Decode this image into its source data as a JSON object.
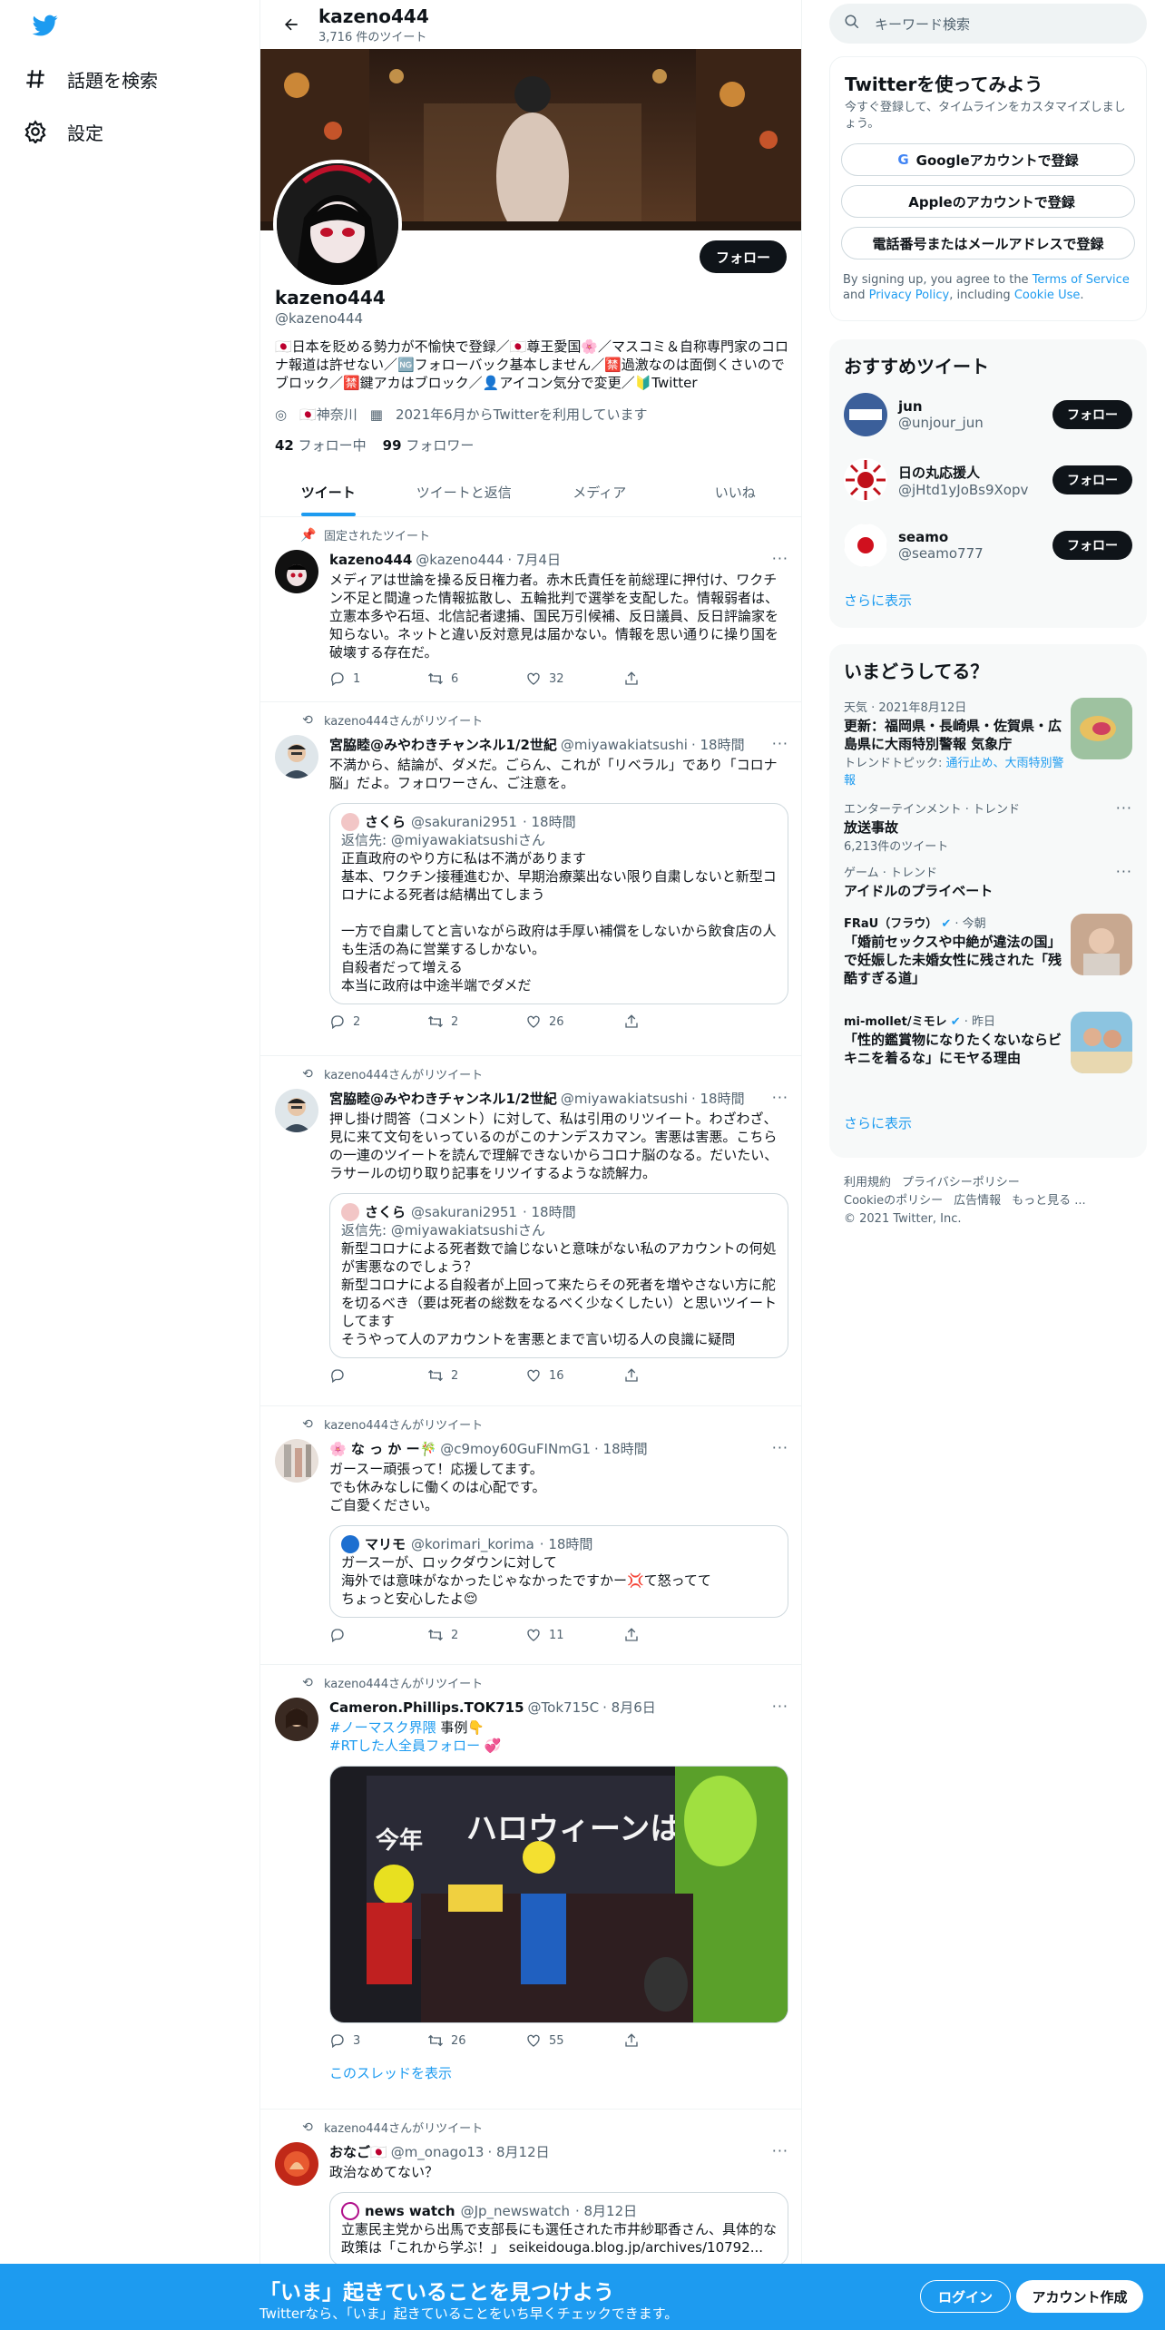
{
  "nav": {
    "explore": "話題を検索",
    "settings": "設定"
  },
  "header": {
    "name": "kazeno444",
    "tweet_count": "3,716 件のツイート"
  },
  "profile": {
    "follow": "フォロー",
    "name": "kazeno444",
    "handle": "@kazeno444",
    "bio": "🇯🇵日本を貶める勢力が不愉快で登録／🇯🇵尊王愛国🌸／マスコミ＆自称専門家のコロナ報道は許せない／🆖フォローバック基本しません／🈲過激なのは面倒くさいのでブロック／🈲鍵アカはブロック／👤アイコン気分で変更／🔰Twitter",
    "location": "🇯🇵神奈川",
    "joined": "2021年6月からTwitterを利用しています",
    "following_count": "42",
    "following_label": "フォロー中",
    "followers_count": "99",
    "followers_label": "フォロワー"
  },
  "tabs": [
    "ツイート",
    "ツイートと返信",
    "メディア",
    "いいね"
  ],
  "tweets": [
    {
      "context": "固定されたツイート",
      "name": "kazeno444",
      "handle": "@kazeno444",
      "date": "· 7月4日",
      "text": "メディアは世論を操る反日権力者。赤木氏責任を前総理に押付け、ワクチン不足と間違った情報拡散し、五輪批判で選挙を支配した。情報弱者は、立憲本多や石垣、北信記者逮捕、国民万引候補、反日議員、反日評論家を知らない。ネットと違い反対意見は届かない。情報を思い通りに操り国を破壊する存在だ。",
      "replies": "1",
      "retweets": "6",
      "likes": "32"
    },
    {
      "context": "kazeno444さんがリツイート",
      "name": "宮脇睦@みやわきチャンネル1/2世紀",
      "handle": "@miyawakiatsushi",
      "date": "· 18時間",
      "text": "不満から、結論が、ダメだ。ごらん、これが「リベラル」であり「コロナ脳」だよ。フォロワーさん、ご注意を。",
      "quote": {
        "name": "さくら",
        "handle": "@sakurani2951",
        "date": "· 18時間",
        "reply_to": "返信先: @miyawakiatsushiさん",
        "text": "正直政府のやり方に私は不満があります\n基本、ワクチン接種進むか、早期治療薬出ない限り自粛しないと新型コロナによる死者は結構出てしまう\n\n一方で自粛してと言いながら政府は手厚い補償をしないから飲食店の人も生活の為に営業するしかない。\n自殺者だって増える\n本当に政府は中途半端でダメだ"
      },
      "replies": "2",
      "retweets": "2",
      "likes": "26"
    },
    {
      "context": "kazeno444さんがリツイート",
      "name": "宮脇睦@みやわきチャンネル1/2世紀",
      "handle": "@miyawakiatsushi",
      "date": "· 18時間",
      "text": "押し掛け問答（コメント）に対して、私は引用のリツイート。わざわざ、見に来て文句をいっているのがこのナンデスカマン。害悪は害悪。こちらの一連のツイートを読んで理解できないからコロナ脳のなる。だいたい、ラサールの切り取り記事をリツイするような読解力。",
      "quote": {
        "name": "さくら",
        "handle": "@sakurani2951",
        "date": "· 18時間",
        "reply_to": "返信先: @miyawakiatsushiさん",
        "text": "新型コロナによる死者数で論じないと意味がない私のアカウントの何処が害悪なのでしょう？\n新型コロナによる自殺者が上回って来たらその死者を増やさない方に舵を切るべき（要は死者の総数をなるべく少なくしたい）と思いツイートしてます\nそうやって人のアカウントを害悪とまで言い切る人の良識に疑問"
      },
      "replies": "",
      "retweets": "2",
      "likes": "16"
    },
    {
      "context": "kazeno444さんがリツイート",
      "name": "🌸 な っ か ー🎋",
      "handle": "@c9moy60GuFINmG1",
      "date": "· 18時間",
      "text": "ガースー頑張って！応援してます。\nでも休みなしに働くのは心配です。\nご自愛ください。",
      "quote": {
        "name": "マリモ",
        "handle": "@korimari_korima",
        "date": "· 18時間",
        "reply_to": "",
        "text": "ガースーが、ロックダウンに対して\n海外では意味がなかったじゃなかったですかー💢て怒ってて\nちょっと安心したよ😌"
      },
      "replies": "",
      "retweets": "2",
      "likes": "11"
    },
    {
      "context": "kazeno444さんがリツイート",
      "name": "Cameron.Phillips.TOK715",
      "handle": "@Tok715C",
      "date": "· 8月6日",
      "line1_tag": "#ノーマスク界隈",
      "line1_rest": " 事例👇",
      "line2_tag": "#RTした人全員フォロー",
      "line2_rest": " 💞",
      "image_text": "ハロウィーンは、",
      "image_text2": "今年",
      "replies": "3",
      "retweets": "26",
      "likes": "55",
      "thread": "このスレッドを表示"
    },
    {
      "context": "kazeno444さんがリツイート",
      "name": "おなご🇯🇵",
      "handle": "@m_onago13",
      "date": "· 8月12日",
      "text": "政治なめてない？",
      "quote": {
        "name": "news watch",
        "handle": "@Jp_newswatch",
        "date": "· 8月12日",
        "reply_to": "",
        "text": "立憲民主党から出馬で支部長にも選任された市井紗耶香さん、具体的な政策は「これから学ぶ！」 seikeidouga.blog.jp/archives/10792..."
      }
    }
  ],
  "right": {
    "search_placeholder": "キーワード検索",
    "signup": {
      "title": "Twitterを使ってみよう",
      "subtitle": "今すぐ登録して、タイムラインをカスタマイズしましょう。",
      "google": "Googleアカウントで登録",
      "apple": "Appleのアカウントで登録",
      "phone": "電話番号またはメールアドレスで登録",
      "terms_pre": "By signing up, you agree to the ",
      "terms_link": "Terms of Service",
      "terms_mid": " and ",
      "privacy_link": "Privacy Policy",
      "terms_mid2": ", including ",
      "cookie_link": "Cookie Use",
      "terms_end": "."
    },
    "wtf": {
      "title": "おすすめツイート",
      "users": [
        {
          "name": "jun",
          "handle": "@unjour_jun",
          "follow": "フォロー"
        },
        {
          "name": "日の丸応援人",
          "handle": "@jHtd1yJoBs9Xopv",
          "follow": "フォロー"
        },
        {
          "name": "seamo",
          "handle": "@seamo777",
          "follow": "フォロー"
        }
      ],
      "more": "さらに表示"
    },
    "trends": {
      "title": "いまどうしてる？",
      "items": [
        {
          "cat": "天気 · 2021年8月12日",
          "title": "更新：福岡県・長崎県・佐賀県・広島県に大雨特別警報 気象庁",
          "sub_pre": "トレンドトピック: ",
          "sub_links": "通行止め、大雨特別警報"
        },
        {
          "cat": "エンターテインメント · トレンド",
          "title": "放送事故",
          "sub": "6,213件のツイート"
        },
        {
          "cat": "ゲーム · トレンド",
          "title": "アイドルのプライベート"
        },
        {
          "cat": "FRaU（フラウ）",
          "time": "· 今朝",
          "title": "「婚前セックスや中絶が違法の国」で妊娠した未婚女性に残された「残酷すぎる道」"
        },
        {
          "cat": "mi-mollet/ミモレ",
          "time": "· 昨日",
          "title": "「性的鑑賞物になりたくないならビキニを着るな」にモヤる理由"
        }
      ],
      "more": "さらに表示"
    },
    "footer": [
      "利用規約",
      "プライバシーポリシー",
      "Cookieのポリシー",
      "広告情報",
      "もっと見る ...",
      "© 2021 Twitter, Inc."
    ]
  },
  "bottom": {
    "title": "「いま」起きていることを見つけよう",
    "subtitle": "Twitterなら、「いま」起きていることをいち早くチェックできます。",
    "login": "ログイン",
    "signup": "アカウント作成"
  },
  "colors": {
    "accent": "#1d9bf0",
    "text": "#0f1419",
    "muted": "#536471"
  }
}
